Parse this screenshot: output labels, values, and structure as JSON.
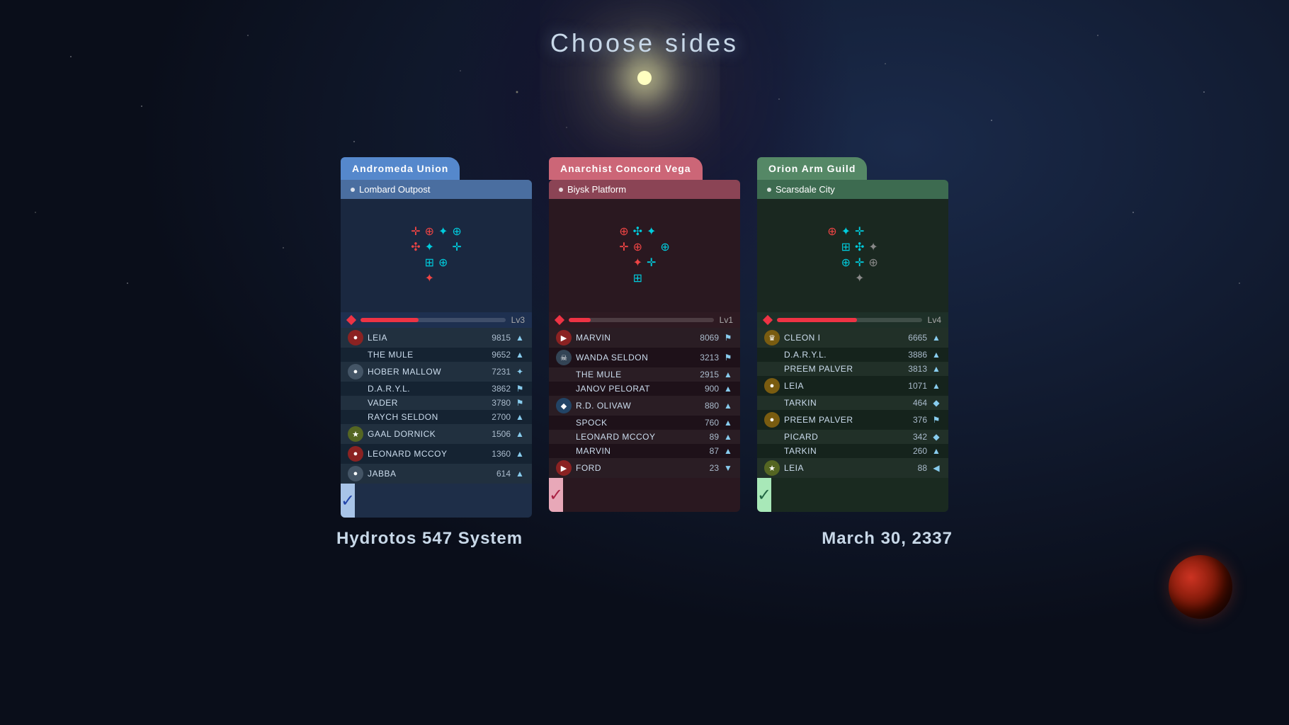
{
  "title": "Choose sides",
  "subtitle_left": "Hydrotos 547 System",
  "subtitle_right": "March 30, 2337",
  "factions": [
    {
      "id": "andromeda",
      "name": "Andromeda Union",
      "location": "Lombard Outpost",
      "level": "Lv3",
      "level_fill": "40%",
      "theme": "blue",
      "select_label": "✓",
      "players": [
        {
          "name": "LEIA",
          "score": "9815",
          "has_avatar": true,
          "avatar_type": "red",
          "avatar_char": "●",
          "arrow": "▲"
        },
        {
          "name": "THE MULE",
          "score": "9652",
          "has_avatar": false,
          "arrow": "▲"
        },
        {
          "name": "HOBER MALLOW",
          "score": "7231",
          "has_avatar": true,
          "avatar_type": "gray",
          "avatar_char": "●",
          "arrow": "✦"
        },
        {
          "name": "D.A.R.Y.L.",
          "score": "3862",
          "has_avatar": false,
          "arrow": "⚑"
        },
        {
          "name": "VADER",
          "score": "3780",
          "has_avatar": false,
          "arrow": "⚑"
        },
        {
          "name": "RAYCH SELDON",
          "score": "2700",
          "has_avatar": false,
          "arrow": "▲"
        },
        {
          "name": "GAAL DORNICK",
          "score": "1506",
          "has_avatar": true,
          "avatar_type": "star",
          "avatar_char": "★",
          "arrow": "▲"
        },
        {
          "name": "LEONARD MCCOY",
          "score": "1360",
          "has_avatar": true,
          "avatar_type": "red",
          "avatar_char": "●",
          "arrow": "▲"
        },
        {
          "name": "JABBA",
          "score": "614",
          "has_avatar": true,
          "avatar_type": "gray",
          "avatar_char": "●",
          "arrow": "▲"
        }
      ]
    },
    {
      "id": "anarchist",
      "name": "Anarchist Concord Vega",
      "location": "Biysk Platform",
      "level": "Lv1",
      "level_fill": "15%",
      "theme": "pink",
      "select_label": "✓",
      "players": [
        {
          "name": "MARVIN",
          "score": "8069",
          "has_avatar": true,
          "avatar_type": "red",
          "avatar_char": "▶",
          "arrow": "⚑"
        },
        {
          "name": "WANDA SELDON",
          "score": "3213",
          "has_avatar": true,
          "avatar_type": "skull",
          "avatar_char": "☠",
          "arrow": "⚑"
        },
        {
          "name": "THE MULE",
          "score": "2915",
          "has_avatar": false,
          "arrow": "▲"
        },
        {
          "name": "JANOV PELORAT",
          "score": "900",
          "has_avatar": false,
          "arrow": "▲"
        },
        {
          "name": "R.D. OLIVAW",
          "score": "880",
          "has_avatar": true,
          "avatar_type": "blue",
          "avatar_char": "◆",
          "arrow": "▲"
        },
        {
          "name": "SPOCK",
          "score": "760",
          "has_avatar": false,
          "arrow": "▲"
        },
        {
          "name": "LEONARD MCCOY",
          "score": "89",
          "has_avatar": false,
          "arrow": "▲"
        },
        {
          "name": "MARVIN",
          "score": "87",
          "has_avatar": false,
          "arrow": "▲"
        },
        {
          "name": "FORD",
          "score": "23",
          "has_avatar": true,
          "avatar_type": "red",
          "avatar_char": "▶",
          "arrow": "▼"
        }
      ]
    },
    {
      "id": "orion",
      "name": "Orion Arm Guild",
      "location": "Scarsdale City",
      "level": "Lv4",
      "level_fill": "55%",
      "theme": "green",
      "select_label": "✓",
      "players": [
        {
          "name": "CLEON I",
          "score": "6665",
          "has_avatar": true,
          "avatar_type": "gold",
          "avatar_char": "♛",
          "arrow": "▲"
        },
        {
          "name": "D.A.R.Y.L.",
          "score": "3886",
          "has_avatar": false,
          "arrow": "▲"
        },
        {
          "name": "PREEM PALVER",
          "score": "3813",
          "has_avatar": false,
          "arrow": "▲"
        },
        {
          "name": "LEIA",
          "score": "1071",
          "has_avatar": true,
          "avatar_type": "gold",
          "avatar_char": "●",
          "arrow": "▲"
        },
        {
          "name": "TARKIN",
          "score": "464",
          "has_avatar": false,
          "arrow": "◆"
        },
        {
          "name": "PREEM PALVER",
          "score": "376",
          "has_avatar": true,
          "avatar_type": "gold",
          "avatar_char": "●",
          "arrow": "⚑"
        },
        {
          "name": "PICARD",
          "score": "342",
          "has_avatar": false,
          "arrow": "◆"
        },
        {
          "name": "TARKIN",
          "score": "260",
          "has_avatar": false,
          "arrow": "▲"
        },
        {
          "name": "LEIA",
          "score": "88",
          "has_avatar": true,
          "avatar_type": "star",
          "avatar_char": "★",
          "arrow": "◀"
        }
      ]
    }
  ]
}
